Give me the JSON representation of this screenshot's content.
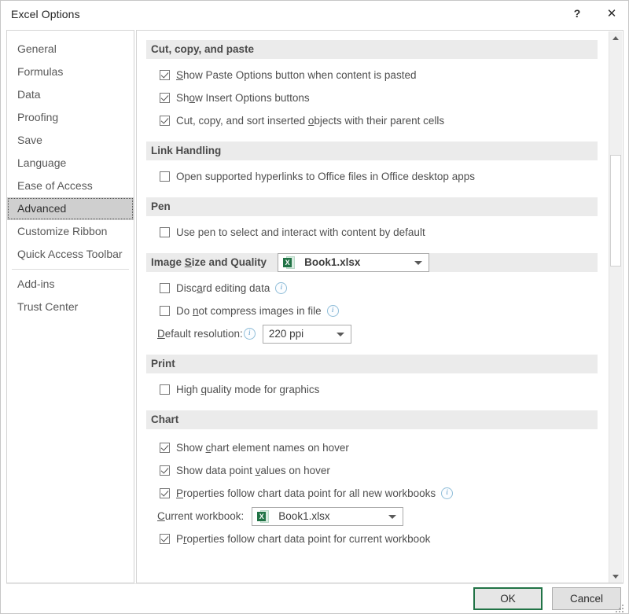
{
  "window": {
    "title": "Excel Options",
    "help_label": "?",
    "close_label": "✕"
  },
  "sidebar": {
    "items": [
      {
        "label": "General",
        "selected": false
      },
      {
        "label": "Formulas",
        "selected": false
      },
      {
        "label": "Data",
        "selected": false
      },
      {
        "label": "Proofing",
        "selected": false
      },
      {
        "label": "Save",
        "selected": false
      },
      {
        "label": "Language",
        "selected": false
      },
      {
        "label": "Ease of Access",
        "selected": false
      },
      {
        "label": "Advanced",
        "selected": true
      },
      {
        "label": "Customize Ribbon",
        "selected": false
      },
      {
        "label": "Quick Access Toolbar",
        "selected": false
      },
      {
        "label": "Add-ins",
        "selected": false
      },
      {
        "label": "Trust Center",
        "selected": false
      }
    ]
  },
  "sections": {
    "cut_copy_paste": {
      "heading": "Cut, copy, and paste",
      "options": [
        {
          "pre": "",
          "acc": "S",
          "post": "how Paste Options button when content is pasted",
          "checked": true
        },
        {
          "pre": "Sh",
          "acc": "o",
          "post": "w Insert Options buttons",
          "checked": true
        },
        {
          "pre": "Cut, copy, and sort inserted ",
          "acc": "o",
          "post": "bjects with their parent cells",
          "checked": true
        }
      ]
    },
    "link_handling": {
      "heading": "Link Handling",
      "options": [
        {
          "pre": "Open supported hyperlinks to Office files in Office desktop apps",
          "acc": "",
          "post": "",
          "checked": false
        }
      ]
    },
    "pen": {
      "heading": "Pen",
      "options": [
        {
          "pre": "Use pen to select and interact with content by default",
          "acc": "",
          "post": "",
          "checked": false
        }
      ]
    },
    "image_size_quality": {
      "heading_pre": "Image ",
      "heading_acc": "S",
      "heading_post": "ize and Quality",
      "workbook_combo": {
        "value": "Book1.xlsx",
        "icon_letter": "X"
      },
      "options": [
        {
          "pre": "Disc",
          "acc": "a",
          "post": "rd editing data",
          "checked": false,
          "info": true
        },
        {
          "pre": "Do ",
          "acc": "n",
          "post": "ot compress images in file",
          "checked": false,
          "info": true
        }
      ],
      "resolution": {
        "label_pre": "",
        "label_acc": "D",
        "label_post": "efault resolution:",
        "info": true,
        "value": "220 ppi"
      }
    },
    "print": {
      "heading": "Print",
      "options": [
        {
          "pre": "High ",
          "acc": "q",
          "post": "uality mode for graphics",
          "checked": false
        }
      ]
    },
    "chart": {
      "heading": "Chart",
      "options_top": [
        {
          "pre": "Show ",
          "acc": "c",
          "post": "hart element names on hover",
          "checked": true,
          "info": false
        },
        {
          "pre": "Show data point ",
          "acc": "v",
          "post": "alues on hover",
          "checked": true,
          "info": false
        },
        {
          "pre": "",
          "acc": "P",
          "post": "roperties follow chart data point for all new workbooks",
          "checked": true,
          "info": true
        }
      ],
      "current_workbook": {
        "label_pre": "",
        "label_acc": "C",
        "label_post": "urrent workbook:",
        "value": "Book1.xlsx",
        "icon_letter": "X"
      },
      "options_bottom": [
        {
          "pre": "P",
          "acc": "r",
          "post": "operties follow chart data point for current workbook",
          "checked": true,
          "info": false
        }
      ]
    }
  },
  "scrollbar": {
    "up_arrow": "▲",
    "down_arrow": "▼"
  },
  "footer": {
    "ok_label": "OK",
    "cancel_label": "Cancel"
  },
  "colors": {
    "accent_green": "#217346",
    "section_band": "#ebebeb",
    "selected_nav": "#cfcfcf",
    "info_blue": "#4b8fc0"
  },
  "icons": {
    "info": "ⓘ"
  }
}
